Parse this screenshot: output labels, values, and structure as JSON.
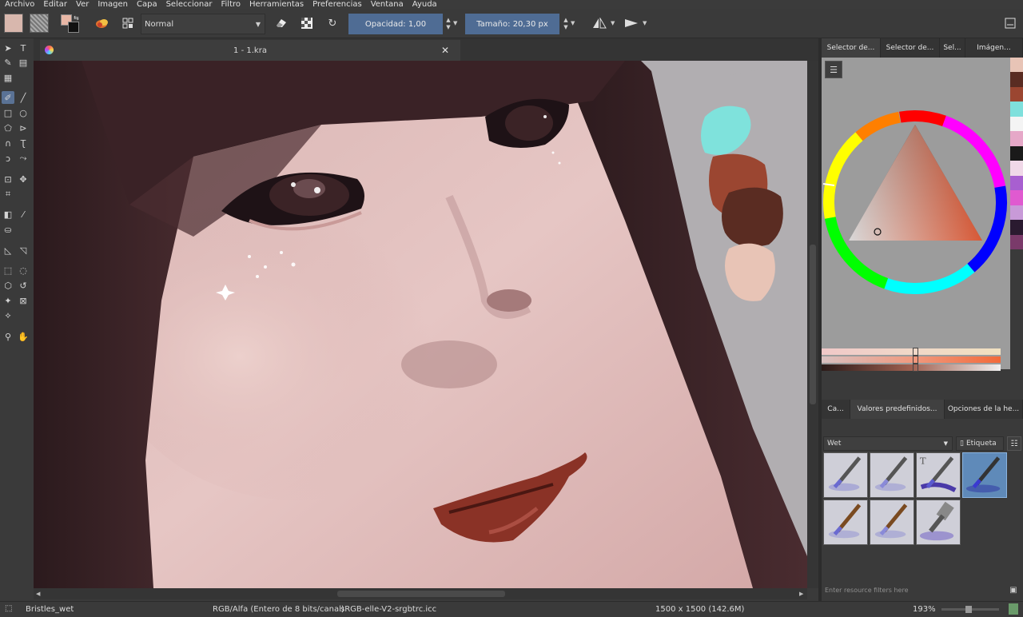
{
  "menubar": [
    "Archivo",
    "Editar",
    "Ver",
    "Imagen",
    "Capa",
    "Seleccionar",
    "Filtro",
    "Herramientas",
    "Preferencias",
    "Ventana",
    "Ayuda"
  ],
  "tool_options": {
    "blend_mode": "Normal",
    "opacity_label": "Opacidad:",
    "opacity_value": "1,00",
    "size_label": "Tamaño:",
    "size_value": "20,30 px"
  },
  "document": {
    "tab_title": "1 - 1.kra"
  },
  "dock": {
    "top_tabs": [
      "Selector de...",
      "Selector de...",
      "Sel...",
      "Imágen..."
    ],
    "color_history": [
      "#e8c4b6",
      "#5a2c22",
      "#9b4631",
      "#7fe0dc",
      "#f4f4f4",
      "#e6a8c8",
      "#1a1a1a",
      "#f0d8e8",
      "#a85fd0",
      "#e05ad0",
      "#c89ad8",
      "#2a1a30",
      "#7a3a6a"
    ],
    "preset_tabs": [
      "Ca...",
      "Valores predefinidos...",
      "Opciones de la he..."
    ],
    "preset_filter": "Wet",
    "tag_label": "Etiqueta",
    "resource_filter_placeholder": "Enter resource filters here"
  },
  "status": {
    "brush_name": "Bristles_wet",
    "color_model": "RGB/Alfa (Entero de 8 bits/canal)",
    "profile": "sRGB-elle-V2-srgbtrc.icc",
    "image_size": "1500 x 1500 (142.6M)",
    "zoom": "193%"
  },
  "colors": {
    "fg_color": "#e8b7a6",
    "selection_accent": "#5a7295",
    "slider_accent": "#4f6c94"
  }
}
